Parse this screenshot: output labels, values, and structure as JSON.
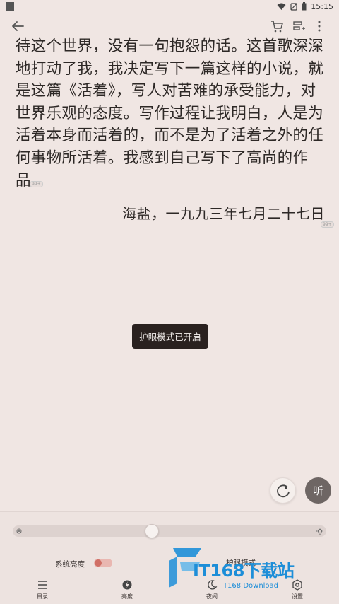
{
  "status_bar": {
    "time": "15:15"
  },
  "toolbar": {
    "back_icon": "arrow-left-icon",
    "cart_icon": "cart-icon",
    "add_icon": "add-to-shelf-icon",
    "more_icon": "more-vertical-icon"
  },
  "content": {
    "lines": [
      "待这个世界，没有一句抱怨的话。这首歌深深",
      "地打动了我，我决定写下一篇这样的小说，就",
      "是这篇《活着》，写人对苦难的承受能力，对",
      "世界乐观的态度。写作过程让我明白，人是为",
      "活着本身而活着的，而不是为了活着之外的任",
      "何事物所活着。我感到自己写下了高尚的作",
      "品。"
    ],
    "para_mark_1": "99+",
    "signature": "海盐，一九九三年七月二十七日",
    "para_mark_2": "99+"
  },
  "toast": {
    "text": "护眼模式已开启"
  },
  "float_buttons": {
    "listen_label": "听"
  },
  "bottom_panel": {
    "brightness_slider_value": 0.44,
    "system_brightness_label": "系统亮度",
    "system_brightness_on": true,
    "eye_mode_label": "护眼模式",
    "tabs": [
      {
        "label": "目录",
        "icon": "catalog-icon"
      },
      {
        "label": "亮度",
        "icon": "brightness-icon"
      },
      {
        "label": "夜间",
        "icon": "night-icon"
      },
      {
        "label": "设置",
        "icon": "settings-icon"
      }
    ]
  },
  "watermark": {
    "big": "IT168下载站",
    "small": "IT168 Download"
  },
  "colors": {
    "page_bg": "#f0e6e3",
    "toast_bg": "#2a211f",
    "watermark": "#1d8ed8",
    "toggle_on": "#d06f66"
  }
}
